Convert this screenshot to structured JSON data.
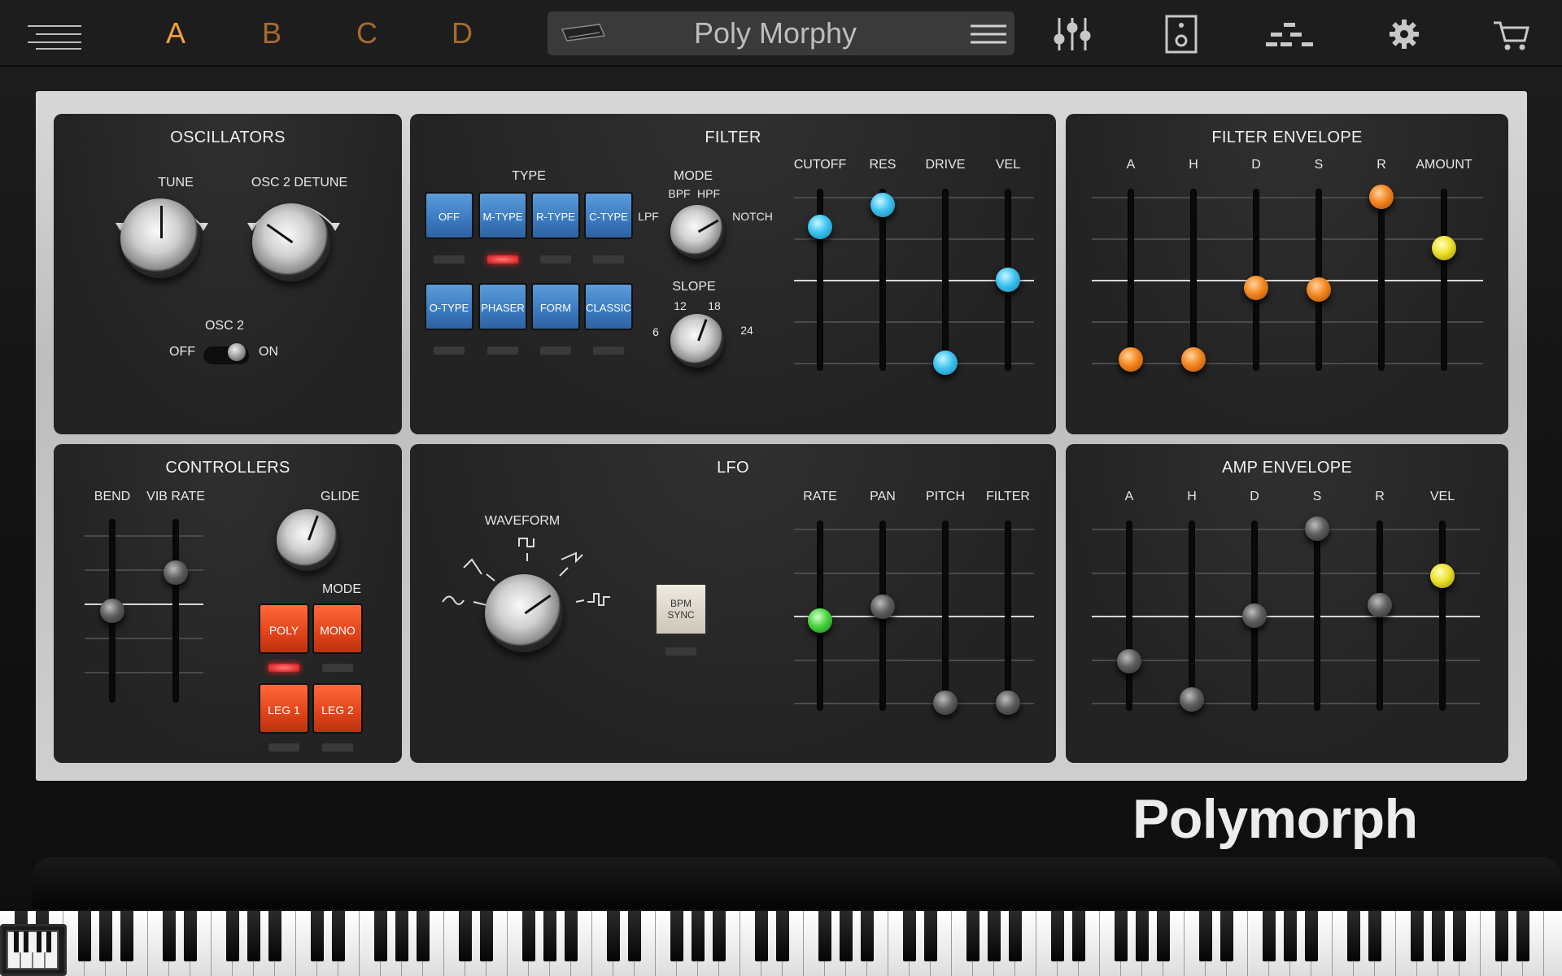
{
  "topbar": {
    "menu_icon": "hamburger-icon",
    "slots": [
      "A",
      "B",
      "C",
      "D"
    ],
    "active_slot": "A",
    "preset_name": "Poly Morphy",
    "icons": [
      "mixer-icon",
      "speaker-icon",
      "sequencer-icon",
      "gear-icon",
      "cart-icon"
    ]
  },
  "oscillators": {
    "title": "OSCILLATORS",
    "tune_label": "TUNE",
    "detune_label": "OSC 2 DETUNE",
    "osc2_label": "OSC 2",
    "off_label": "OFF",
    "on_label": "ON"
  },
  "filter": {
    "title": "FILTER",
    "type_label": "TYPE",
    "types_row1": [
      "OFF",
      "M-TYPE",
      "R-TYPE",
      "C-TYPE"
    ],
    "types_row2": [
      "O-TYPE",
      "PHASER",
      "FORM",
      "CLASSIC"
    ],
    "active_type": "M-TYPE",
    "mode_label": "MODE",
    "mode_options": [
      "LPF",
      "BPF",
      "HPF",
      "NOTCH"
    ],
    "slope_label": "SLOPE",
    "slope_options": [
      "6",
      "12",
      "18",
      "24"
    ],
    "faders": [
      {
        "label": "CUTOFF",
        "value": 0.82,
        "color": "blue"
      },
      {
        "label": "RES",
        "value": 0.95,
        "color": "blue"
      },
      {
        "label": "DRIVE",
        "value": 0.0,
        "color": "blue"
      },
      {
        "label": "VEL",
        "value": 0.5,
        "color": "blue"
      }
    ]
  },
  "filter_envelope": {
    "title": "FILTER ENVELOPE",
    "faders": [
      {
        "label": "A",
        "value": 0.02,
        "color": "orange"
      },
      {
        "label": "H",
        "value": 0.02,
        "color": "orange"
      },
      {
        "label": "D",
        "value": 0.45,
        "color": "orange"
      },
      {
        "label": "S",
        "value": 0.44,
        "color": "orange"
      },
      {
        "label": "R",
        "value": 1.0,
        "color": "orange"
      },
      {
        "label": "AMOUNT",
        "value": 0.69,
        "color": "yellow"
      }
    ]
  },
  "controllers": {
    "title": "CONTROLLERS",
    "bend_label": "BEND",
    "vibrate_label": "VIB RATE",
    "bend_value": 0.5,
    "vibrate_value": 0.73,
    "glide_label": "GLIDE",
    "mode_label": "MODE",
    "mode_buttons": [
      "POLY",
      "MONO",
      "LEG 1",
      "LEG 2"
    ],
    "active_mode": "POLY"
  },
  "lfo": {
    "title": "LFO",
    "waveform_label": "WAVEFORM",
    "bpm_sync_label": "BPM SYNC",
    "faders": [
      {
        "label": "RATE",
        "value": 0.47,
        "color": "green"
      },
      {
        "label": "PAN",
        "value": 0.55,
        "color": "gray"
      },
      {
        "label": "PITCH",
        "value": 0.0,
        "color": "gray"
      },
      {
        "label": "FILTER",
        "value": 0.0,
        "color": "gray"
      }
    ]
  },
  "amp_envelope": {
    "title": "AMP ENVELOPE",
    "faders": [
      {
        "label": "A",
        "value": 0.24,
        "color": "gray"
      },
      {
        "label": "H",
        "value": 0.02,
        "color": "gray"
      },
      {
        "label": "D",
        "value": 0.5,
        "color": "gray"
      },
      {
        "label": "S",
        "value": 1.0,
        "color": "gray"
      },
      {
        "label": "R",
        "value": 0.56,
        "color": "gray"
      },
      {
        "label": "VEL",
        "value": 0.73,
        "color": "yellow"
      }
    ]
  },
  "brand": "Polymorph"
}
